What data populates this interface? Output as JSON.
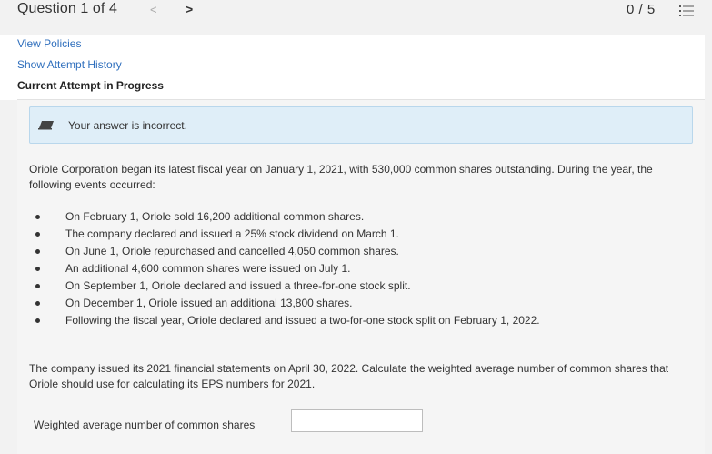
{
  "header": {
    "question_title": "Question 1 of 4",
    "prev_symbol": "<",
    "next_symbol": ">",
    "score": "0 / 5"
  },
  "links": {
    "view_policies": "View Policies",
    "show_attempt_history": "Show Attempt History",
    "current_attempt": "Current Attempt in Progress"
  },
  "feedback": {
    "message": "Your answer is incorrect.",
    "icon": "pencil-icon"
  },
  "problem": {
    "intro": "Oriole Corporation began its latest fiscal year on January 1, 2021, with 530,000 common shares outstanding. During the year, the following events occurred:",
    "events": [
      "On February 1, Oriole sold 16,200 additional common shares.",
      "The company declared and issued a 25% stock dividend on March 1.",
      "On June 1, Oriole repurchased and cancelled 4,050 common shares.",
      "An additional 4,600 common shares were issued on July 1.",
      "On September 1, Oriole declared and issued a three-for-one stock split.",
      "On December 1, Oriole issued an additional 13,800 shares.",
      "Following the fiscal year, Oriole declared and issued a two-for-one stock split on February 1, 2022."
    ],
    "question": "The company issued its 2021 financial statements on April 30, 2022. Calculate the weighted average number of common shares that Oriole should use for calculating its EPS numbers for 2021."
  },
  "answer": {
    "label": "Weighted average number of common shares",
    "value": ""
  },
  "colors": {
    "link": "#2f6fbd",
    "feedback_bg": "#dfeef8",
    "feedback_border": "#b9d7ec"
  }
}
